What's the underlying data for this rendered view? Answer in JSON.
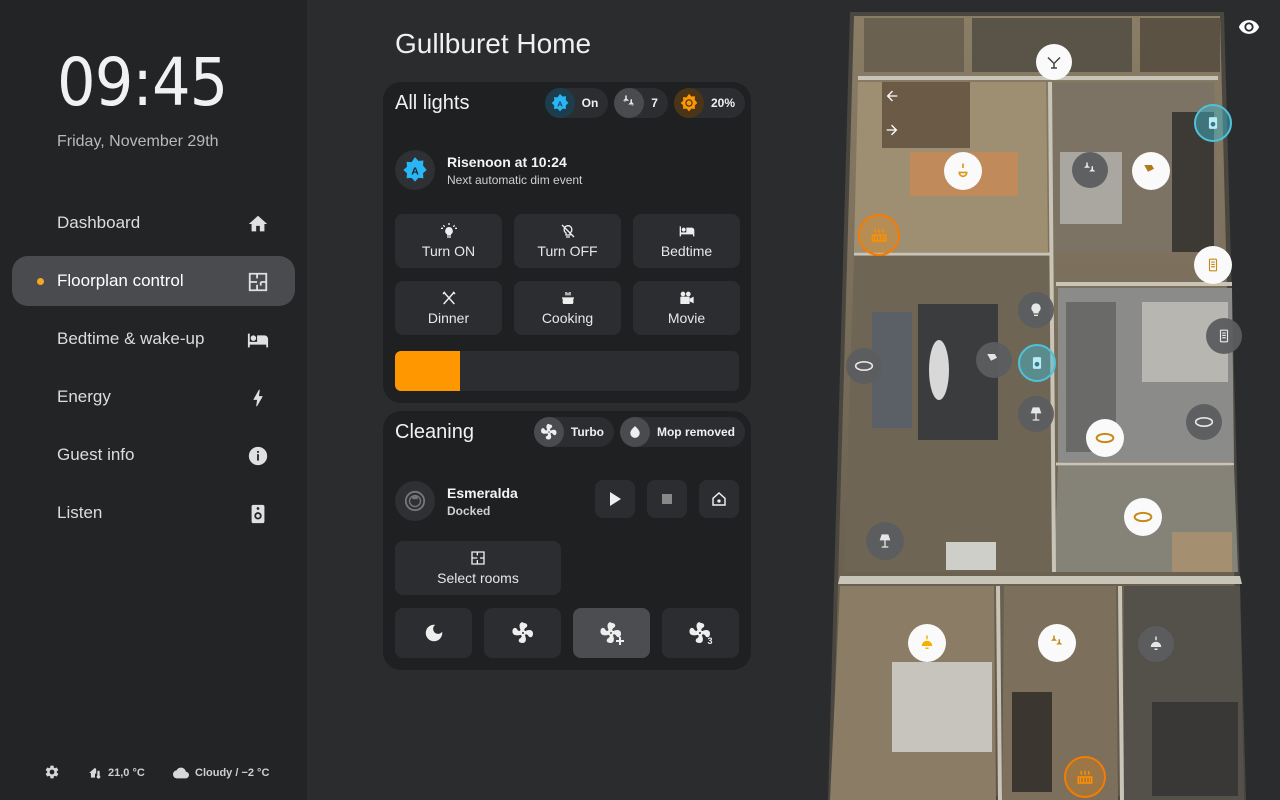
{
  "sidebar": {
    "clock": "09:45",
    "date": "Friday, November 29th",
    "items": [
      {
        "label": "Dashboard",
        "icon": "home-icon",
        "active": false
      },
      {
        "label": "Floorplan control",
        "icon": "floorplan-icon",
        "active": true
      },
      {
        "label": "Bedtime & wake-up",
        "icon": "bed-icon",
        "active": false
      },
      {
        "label": "Energy",
        "icon": "lightning-icon",
        "active": false
      },
      {
        "label": "Guest info",
        "icon": "info-icon",
        "active": false
      },
      {
        "label": "Listen",
        "icon": "speaker-icon",
        "active": false
      }
    ],
    "footer": {
      "indoor_temp": "21,0 °C",
      "weather": "Cloudy / −2 °C"
    }
  },
  "main": {
    "title": "Gullburet Home",
    "lights": {
      "title": "All lights",
      "chips": [
        {
          "icon": "auto-brightness-icon",
          "label": "On",
          "color": "#29b6f6"
        },
        {
          "icon": "ceiling-lights-icon",
          "label": "7",
          "color": "#e0e0e0"
        },
        {
          "icon": "brightness-icon",
          "label": "20%",
          "color": "#ff9800"
        }
      ],
      "event_title": "Risenoon at 10:24",
      "event_subtitle": "Next automatic dim event",
      "buttons": [
        {
          "label": "Turn ON",
          "icon": "lightbulb-on-icon"
        },
        {
          "label": "Turn OFF",
          "icon": "lightbulb-off-icon"
        },
        {
          "label": "Bedtime",
          "icon": "bed-icon"
        },
        {
          "label": "Dinner",
          "icon": "cutlery-icon"
        },
        {
          "label": "Cooking",
          "icon": "pot-icon"
        },
        {
          "label": "Movie",
          "icon": "movie-camera-icon"
        }
      ],
      "brightness_fraction": 0.19,
      "accent": "#ff9800"
    },
    "cleaning": {
      "title": "Cleaning",
      "chips": [
        {
          "icon": "fan-icon",
          "label": "Turbo"
        },
        {
          "icon": "water-drop-icon",
          "label": "Mop removed"
        }
      ],
      "vacuum_name": "Esmeralda",
      "vacuum_status": "Docked",
      "select_rooms_label": "Select rooms",
      "fan_modes": [
        "quiet",
        "standard",
        "turbo-plus",
        "max"
      ],
      "active_fan_mode": "turbo-plus"
    }
  }
}
